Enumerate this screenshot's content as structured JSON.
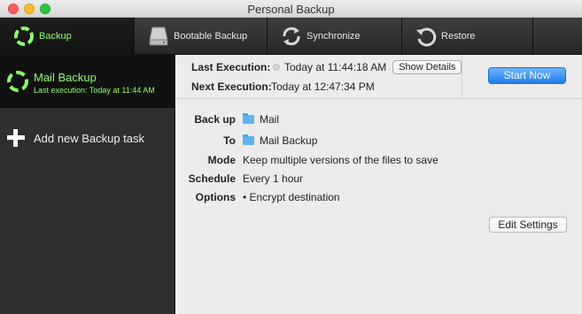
{
  "window": {
    "title": "Personal Backup"
  },
  "toolbar": {
    "items": [
      {
        "label": "Backup",
        "icon": "backup-ring-icon",
        "active": true
      },
      {
        "label": "Bootable Backup",
        "icon": "drive-icon",
        "active": false
      },
      {
        "label": "Synchronize",
        "icon": "sync-arrows-icon",
        "active": false
      },
      {
        "label": "Restore",
        "icon": "restore-arrow-icon",
        "active": false
      }
    ]
  },
  "sidebar": {
    "task": {
      "name": "Mail Backup",
      "last_execution": "Last execution: Today at 11:44 AM"
    },
    "add_task_label": "Add new Backup task"
  },
  "execution": {
    "last_label": "Last Execution:",
    "last_value": "Today at 11:44:18 AM",
    "show_details_label": "Show Details",
    "next_label": "Next Execution:",
    "next_value": "Today at 12:47:34 PM",
    "start_now_label": "Start Now"
  },
  "details": {
    "backup_label": "Back up",
    "backup_value": "Mail",
    "to_label": "To",
    "to_value": "Mail Backup",
    "mode_label": "Mode",
    "mode_value": "Keep multiple versions of the files to save",
    "schedule_label": "Schedule",
    "schedule_value": "Every 1 hour",
    "options_label": "Options",
    "options_value": "• Encrypt destination",
    "edit_settings_label": "Edit Settings"
  },
  "colors": {
    "accent_green": "#8aff6a",
    "start_button_blue": "#1f7ff2",
    "folder_blue": "#5fb4ee"
  }
}
